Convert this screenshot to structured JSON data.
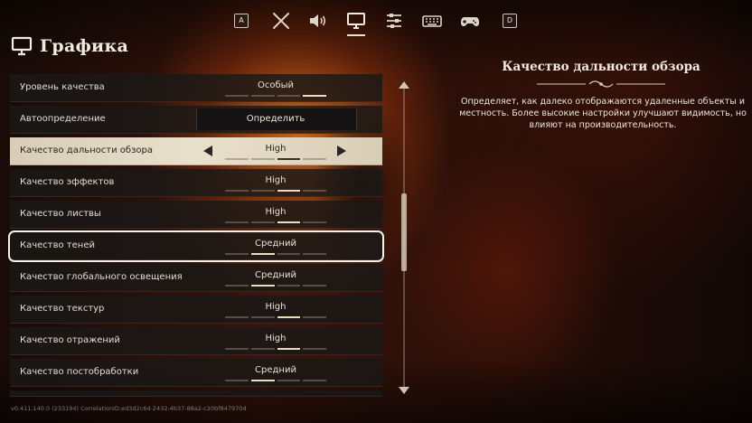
{
  "nav": {
    "left_key": "A",
    "right_key": "D",
    "icons": [
      "crossed-swords-icon",
      "speaker-icon",
      "monitor-icon",
      "sliders-icon",
      "keyboard-icon",
      "gamepad-icon"
    ],
    "active": "monitor-icon"
  },
  "page": {
    "title": "Графика"
  },
  "settings": [
    {
      "label": "Уровень качества",
      "value": "Особый",
      "ticks": 4,
      "level": 4
    },
    {
      "label": "Автоопределение",
      "button": "Определить"
    },
    {
      "label": "Качество дальности обзора",
      "value": "High",
      "ticks": 4,
      "level": 3,
      "selected": true
    },
    {
      "label": "Качество эффектов",
      "value": "High",
      "ticks": 4,
      "level": 3
    },
    {
      "label": "Качество листвы",
      "value": "High",
      "ticks": 4,
      "level": 3
    },
    {
      "label": "Качество теней",
      "value": "Средний",
      "ticks": 4,
      "level": 2,
      "focused": true
    },
    {
      "label": "Качество глобального освещения",
      "value": "Средний",
      "ticks": 4,
      "level": 2
    },
    {
      "label": "Качество текстур",
      "value": "High",
      "ticks": 4,
      "level": 3
    },
    {
      "label": "Качество отражений",
      "value": "High",
      "ticks": 4,
      "level": 3
    },
    {
      "label": "Качество постобработки",
      "value": "Средний",
      "ticks": 4,
      "level": 2
    }
  ],
  "description": {
    "title": "Качество дальности обзора",
    "body": "Определяет, как далеко отображаются удаленные объекты и местность. Более высокие настройки улучшают видимость, но влияют на производительность."
  },
  "footer": {
    "version": "v0.411.140.0 (233194) CorrelationID:ed3d2c6d-2432-4b37-88a2-c20bf847970d"
  },
  "colors": {
    "selected_row": "#e9e0cc",
    "row_bg": "#1a1817",
    "accent_text": "#f2ece0"
  }
}
